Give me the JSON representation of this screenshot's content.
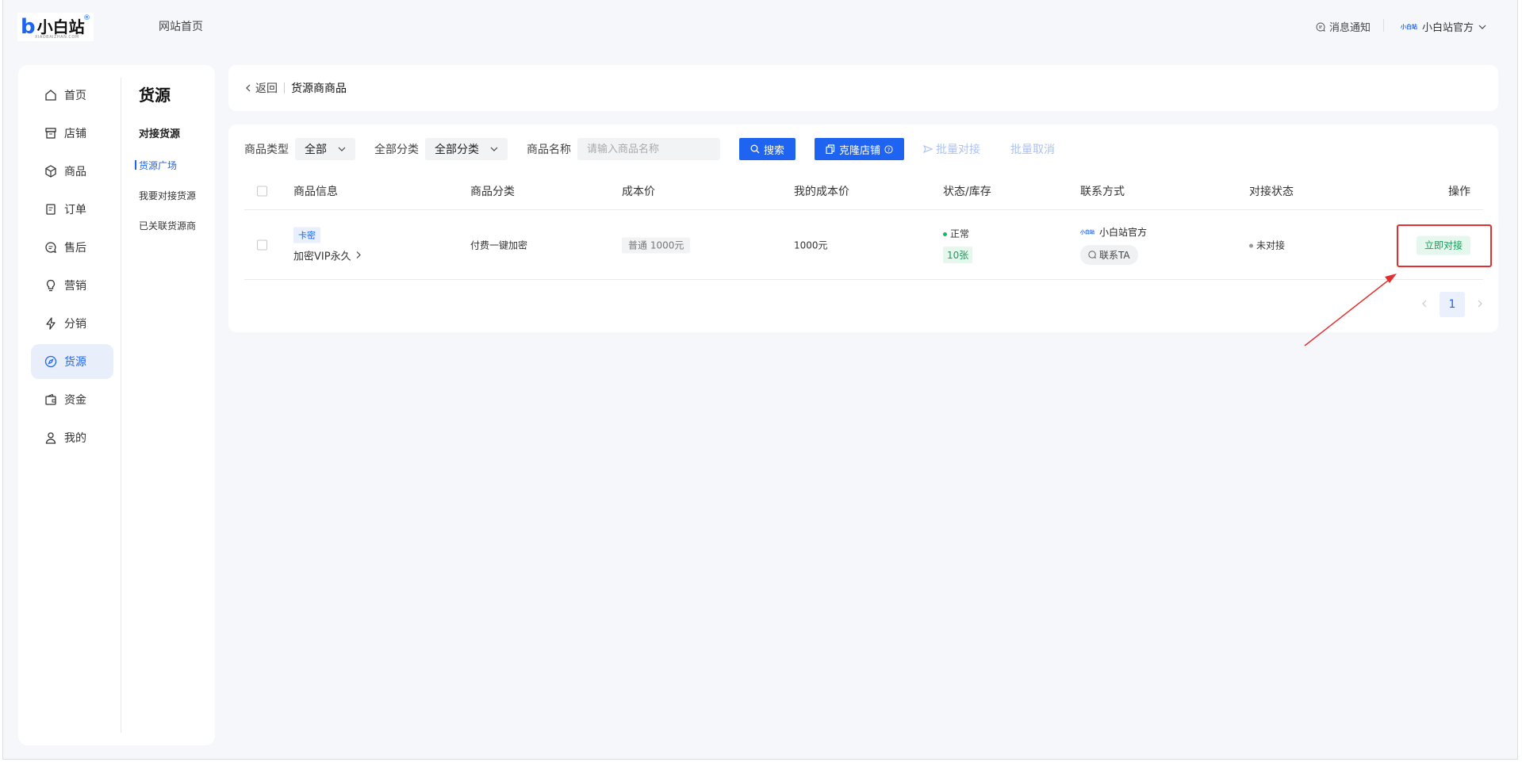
{
  "topbar": {
    "logo_mark": "b",
    "logo_text": "小白站",
    "logo_reg": "®",
    "logo_sub": "XIAOBAIZHAN.COM",
    "site_home": "网站首页",
    "notifications": "消息通知",
    "user_avatar_text": "小白站",
    "user_name": "小白站官方"
  },
  "sidebar": {
    "items": [
      {
        "label": "首页",
        "icon": "home-icon"
      },
      {
        "label": "店铺",
        "icon": "store-icon"
      },
      {
        "label": "商品",
        "icon": "box-icon"
      },
      {
        "label": "订单",
        "icon": "order-icon"
      },
      {
        "label": "售后",
        "icon": "chat-icon"
      },
      {
        "label": "营销",
        "icon": "bulb-icon"
      },
      {
        "label": "分销",
        "icon": "bolt-icon"
      },
      {
        "label": "货源",
        "icon": "compass-icon",
        "active": true
      },
      {
        "label": "资金",
        "icon": "wallet-icon"
      },
      {
        "label": "我的",
        "icon": "user-icon"
      }
    ]
  },
  "subnav": {
    "title": "货源",
    "group": "对接货源",
    "items": [
      "货源广场",
      "我要对接货源",
      "已关联货源商"
    ]
  },
  "breadcrumb": {
    "back": "返回",
    "title": "货源商商品"
  },
  "filters": {
    "type_label": "商品类型",
    "type_value": "全部",
    "category_label": "全部分类",
    "category_value": "全部分类",
    "name_label": "商品名称",
    "name_placeholder": "请输入商品名称",
    "search_button": "搜索",
    "clone_button": "克隆店铺",
    "batch_connect": "批量对接",
    "batch_cancel": "批量取消"
  },
  "table": {
    "headers": [
      "商品信息",
      "商品分类",
      "成本价",
      "我的成本价",
      "状态/库存",
      "联系方式",
      "对接状态",
      "操作"
    ],
    "rows": [
      {
        "tag": "卡密",
        "name": "加密VIP永久",
        "category": "付费一键加密",
        "cost": "普通 1000元",
        "my_cost": "1000元",
        "status": "正常",
        "stock": "10张",
        "contact_logo": "小白站",
        "contact_name": "小白站官方",
        "contact_button": "联系TA",
        "connect_status": "未对接",
        "action": "立即对接"
      }
    ]
  },
  "pagination": {
    "current": "1"
  },
  "colors": {
    "primary": "#1e64f0",
    "success": "#12a05a",
    "highlight": "#e23030"
  }
}
